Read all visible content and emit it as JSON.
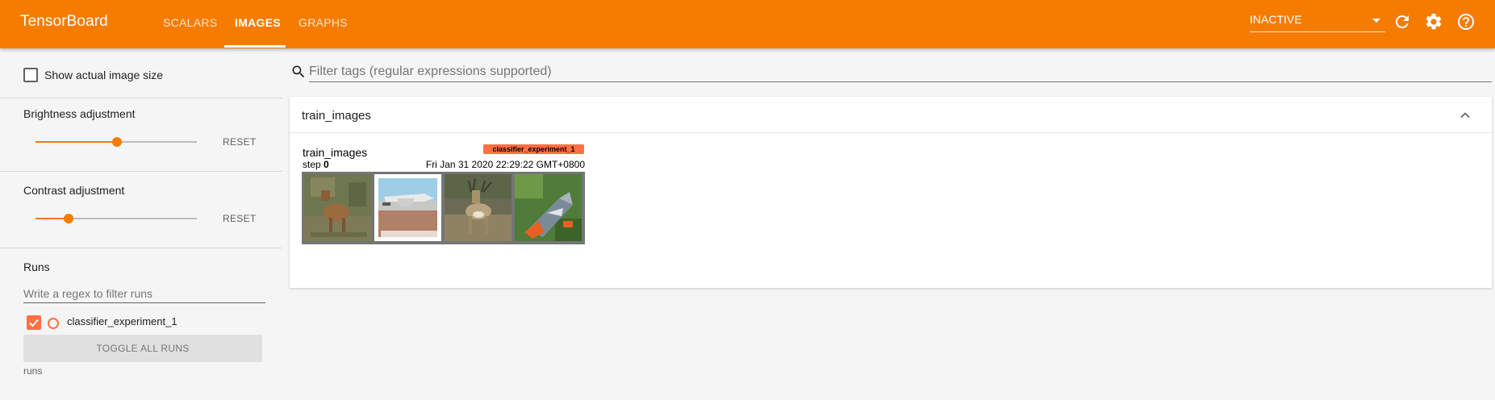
{
  "app": {
    "title": "TensorBoard"
  },
  "nav": {
    "tabs": [
      {
        "label": "SCALARS"
      },
      {
        "label": "IMAGES"
      },
      {
        "label": "GRAPHS"
      }
    ],
    "active_tab": "IMAGES"
  },
  "toolbar": {
    "status_value": "INACTIVE",
    "icons": [
      "refresh-icon",
      "settings-gear-icon",
      "help-icon"
    ]
  },
  "sidebar": {
    "show_actual_size_label": "Show actual image size",
    "show_actual_size_checked": false,
    "brightness": {
      "label": "Brightness adjustment",
      "reset_label": "RESET",
      "value_fraction": 0.5
    },
    "contrast": {
      "label": "Contrast adjustment",
      "reset_label": "RESET",
      "value_fraction": 0.2
    },
    "runs": {
      "title": "Runs",
      "filter_placeholder": "Write a regex to filter runs",
      "items": [
        {
          "name": "classifier_experiment_1",
          "checked": true
        }
      ],
      "toggle_all_label": "TOGGLE ALL RUNS",
      "footer_text": "runs"
    }
  },
  "main": {
    "filter_placeholder": "Filter tags (regular expressions supported)",
    "card": {
      "title": "train_images",
      "image_card": {
        "tag": "train_images",
        "run_badge": "classifier_experiment_1",
        "step_label": "step",
        "step_value": "0",
        "timestamp": "Fri Jan 31 2020 22:29:22 GMT+0800 (GMT+08:00)",
        "thumbnails": [
          "deer-photo",
          "airplane-photo",
          "deer-antlers-photo",
          "bird-photo"
        ]
      }
    }
  },
  "colors": {
    "accent": "#f57c00",
    "run_color": "#ff7043",
    "background": "#f5f5f5"
  }
}
